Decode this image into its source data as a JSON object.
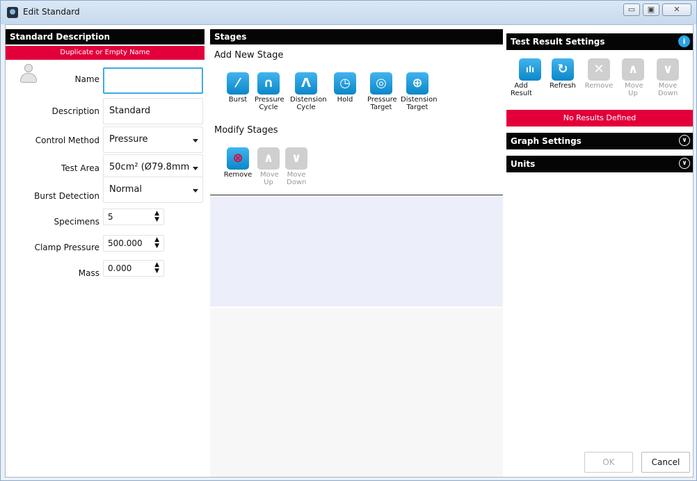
{
  "window": {
    "title": "Edit Standard",
    "min": "▭",
    "max": "▣",
    "close": "✕"
  },
  "standard": {
    "header": "Standard Description",
    "error": "Duplicate or Empty Name",
    "name_label": "Name",
    "name_value": "",
    "desc_label": "Description",
    "desc_value": "Standard description",
    "control_label": "Control Method",
    "control_value": "Pressure",
    "area_label": "Test Area",
    "area_value": "50cm² (Ø79.8mm",
    "burst_label": "Burst Detection",
    "burst_value": "Normal",
    "specimens_label": "Specimens",
    "specimens_value": "5",
    "clamp_label": "Clamp Pressure",
    "clamp_value": "500.000",
    "mass_label": "Mass",
    "mass_value": "0.000"
  },
  "stages": {
    "header": "Stages",
    "add_title": "Add New Stage",
    "add_items": [
      {
        "label": "Burst",
        "glyph": "⁄"
      },
      {
        "label": "Pressure Cycle",
        "glyph": "∩"
      },
      {
        "label": "Distension Cycle",
        "glyph": "Λ"
      },
      {
        "label": "Hold",
        "glyph": "◷"
      },
      {
        "label": "Pressure Target",
        "glyph": "◎"
      },
      {
        "label": "Distension Target",
        "glyph": "⊕"
      }
    ],
    "modify_title": "Modify Stages",
    "modify_items": [
      {
        "label": "Remove",
        "glyph": "⊗"
      },
      {
        "label": "Move Up",
        "glyph": "∧"
      },
      {
        "label": "Move Down",
        "glyph": "∨"
      }
    ]
  },
  "results": {
    "header": "Test Result Settings",
    "info_glyph": "i",
    "items": [
      {
        "label": "Add Result",
        "glyph": "ılı"
      },
      {
        "label": "Refresh",
        "glyph": "↻"
      },
      {
        "label": "Remove",
        "glyph": "✕"
      },
      {
        "label": "Move Up",
        "glyph": "∧"
      },
      {
        "label": "Move Down",
        "glyph": "∨"
      }
    ],
    "empty": "No Results Defined",
    "graph_header": "Graph Settings",
    "units_header": "Units",
    "chev": "∨"
  },
  "footer": {
    "ok": "OK",
    "cancel": "Cancel"
  },
  "colors": {
    "accent": "#0b87c9",
    "error": "#e3003a"
  }
}
